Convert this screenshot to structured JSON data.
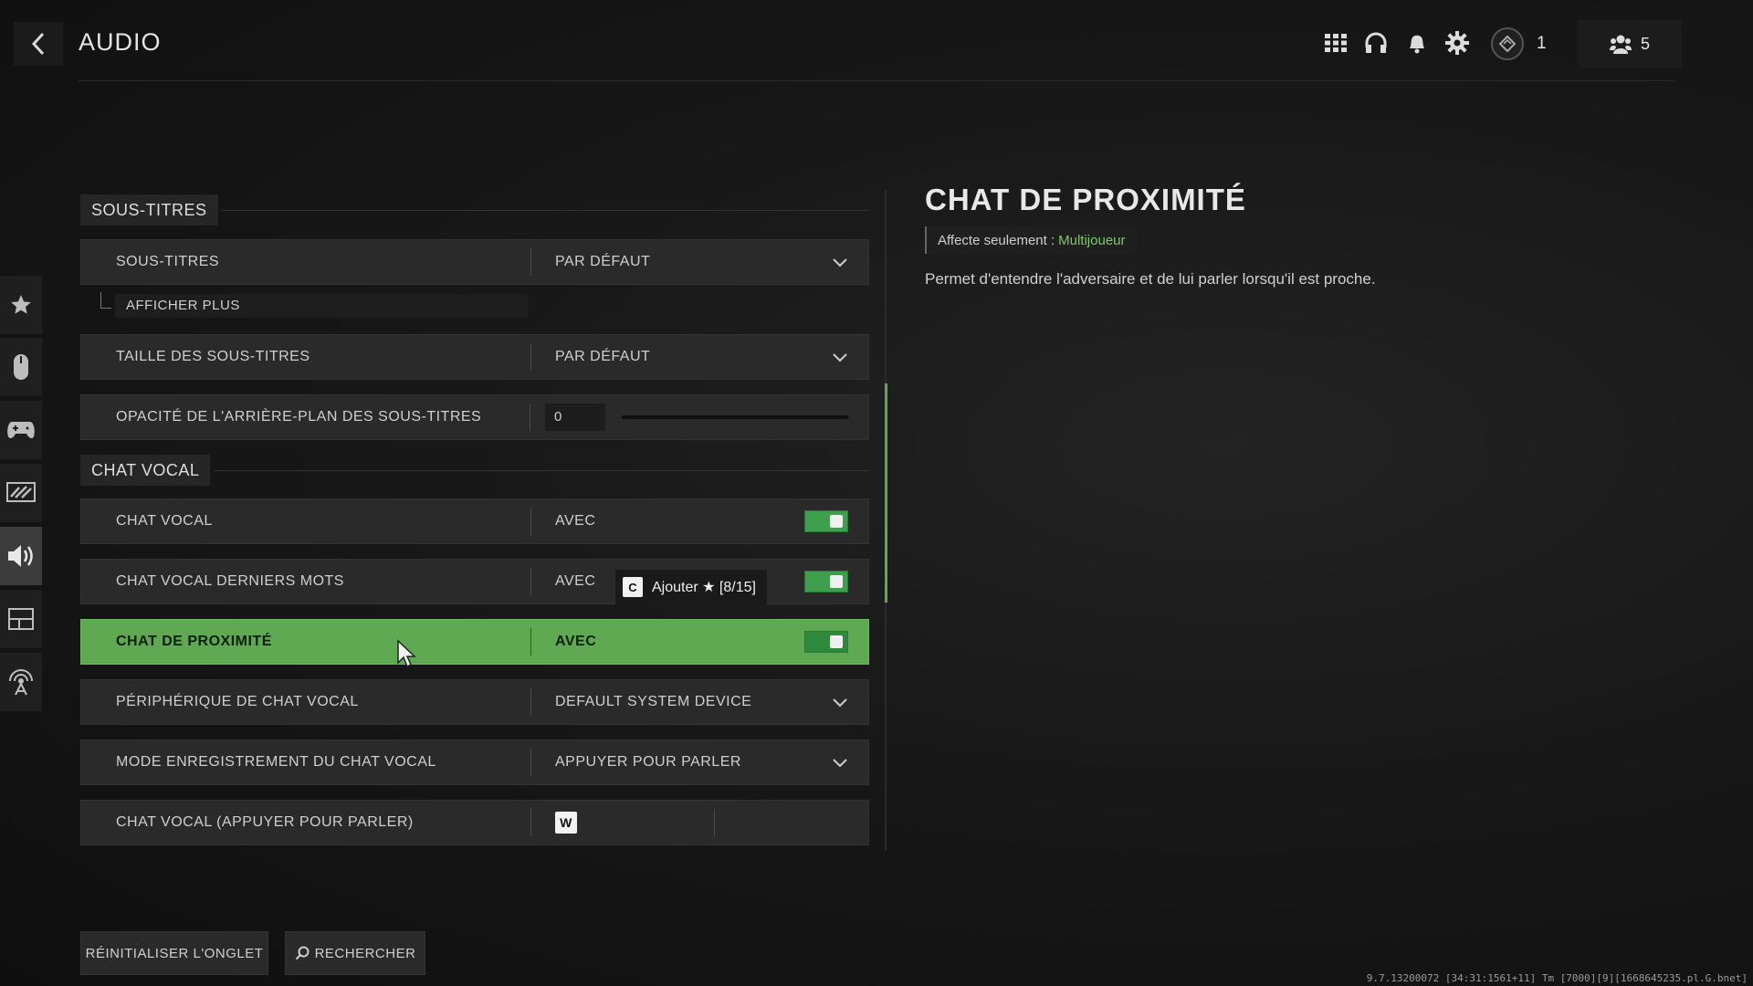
{
  "header": {
    "title": "AUDIO",
    "rank_count": "1",
    "friends_count": "5",
    "icons": [
      "grid-icon",
      "headset-icon",
      "bell-icon",
      "gear-icon",
      "rank-icon",
      "friends-icon"
    ]
  },
  "sidebar": {
    "items": [
      "star-icon",
      "mouse-icon",
      "controller-icon",
      "display-icon",
      "speaker-icon",
      "interface-icon",
      "network-icon"
    ],
    "active": "speaker-icon"
  },
  "sections": {
    "subtitles": {
      "label": "SOUS-TITRES",
      "rows": {
        "subtitles": {
          "name": "SOUS-TITRES",
          "value": "PAR DÉFAUT"
        },
        "show_more": "AFFICHER PLUS",
        "subtitle_size": {
          "name": "TAILLE DES SOUS-TITRES",
          "value": "PAR DÉFAUT"
        },
        "bg_opacity": {
          "name": "OPACITÉ DE L'ARRIÈRE-PLAN DES SOUS-TITRES",
          "value": "0",
          "fill": 0
        }
      }
    },
    "voice_chat": {
      "label": "CHAT VOCAL",
      "rows": {
        "voice_chat": {
          "name": "CHAT VOCAL",
          "value": "AVEC",
          "on": true
        },
        "last_words": {
          "name": "CHAT VOCAL DERNIERS MOTS",
          "value": "AVEC",
          "on": true
        },
        "proximity": {
          "name": "CHAT DE PROXIMITÉ",
          "value": "AVEC",
          "on": true
        },
        "device": {
          "name": "PÉRIPHÉRIQUE DE CHAT VOCAL",
          "value": "DEFAULT SYSTEM DEVICE"
        },
        "record_mode": {
          "name": "MODE ENREGISTREMENT DU CHAT VOCAL",
          "value": "APPUYER POUR PARLER"
        },
        "push_to_talk": {
          "name": "CHAT VOCAL (APPUYER POUR PARLER)",
          "key": "W"
        }
      }
    }
  },
  "tooltip": {
    "key": "C",
    "text": "Ajouter ★ [8/15]"
  },
  "detail": {
    "title": "CHAT DE PROXIMITÉ",
    "affects_label": "Affecte seulement :",
    "affects_mode": "Multijoueur",
    "description": "Permet d'entendre l'adversaire et de lui parler lorsqu'il est proche."
  },
  "footer": {
    "reset_label": "RÉINITIALISER L'ONGLET",
    "search_label": "RECHERCHER",
    "version": "9.7.13200072 [34:31:1561+11] Tm [7000][9][1668645235.pl.G.bnet]"
  },
  "colors": {
    "accent_green": "#5fa953",
    "toggle_green": "#3ea04c",
    "mode_green": "#7ec96b"
  }
}
